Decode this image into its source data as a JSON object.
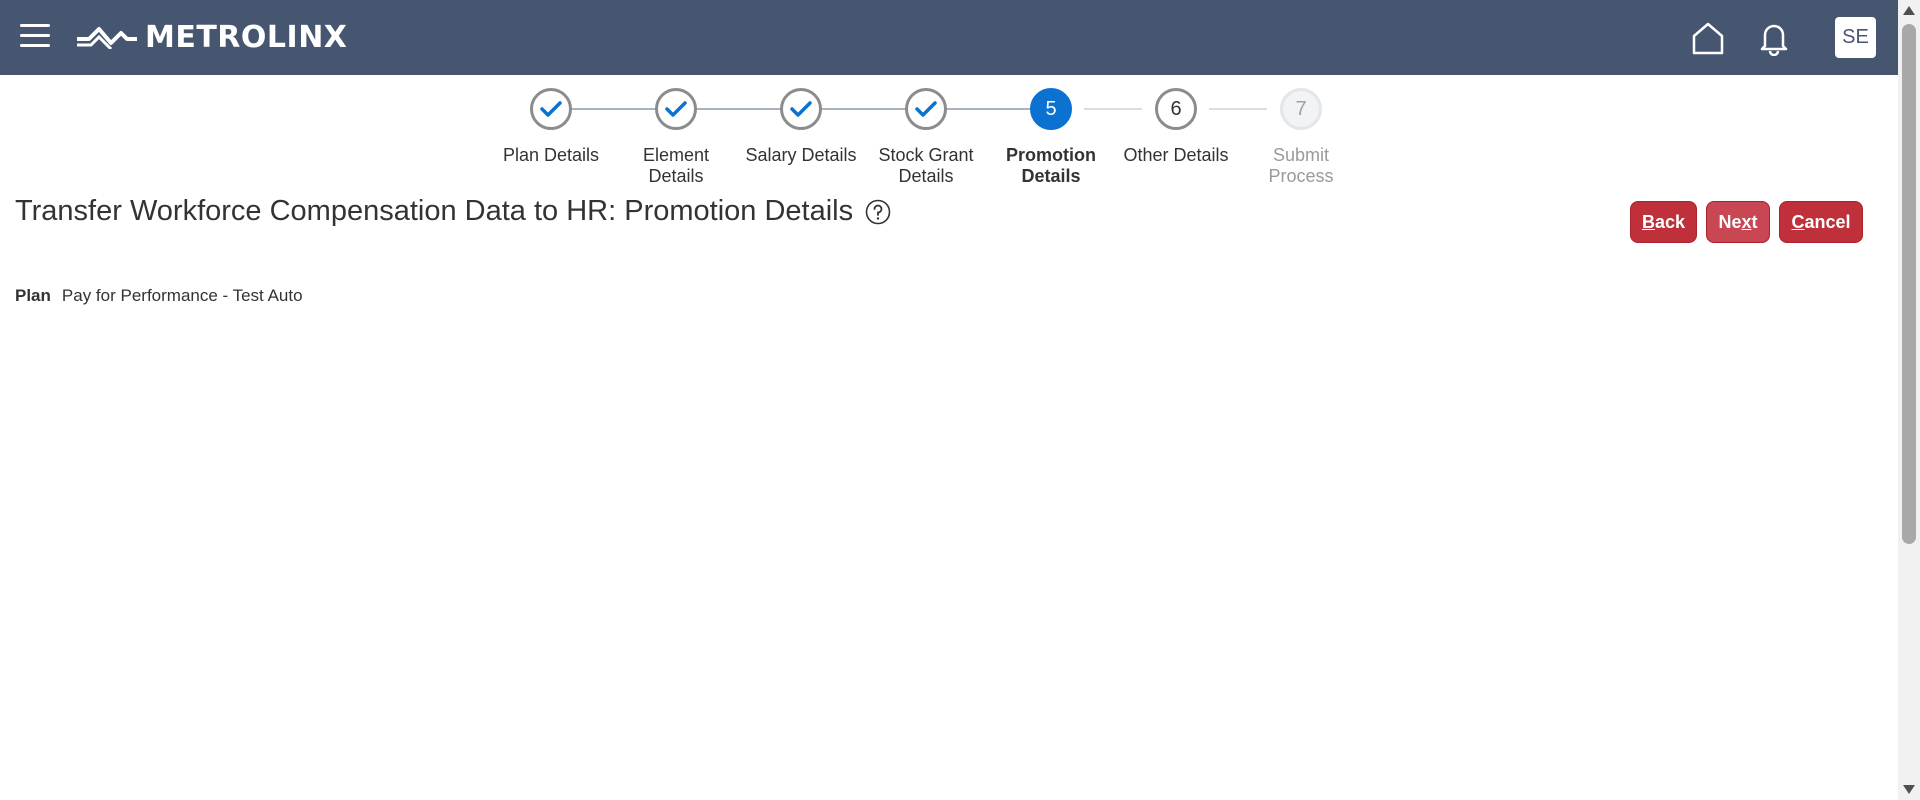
{
  "header": {
    "brand": "METROLINX",
    "avatar_initials": "SE",
    "bg_color": "#475670"
  },
  "train": {
    "steps": [
      {
        "marker": "",
        "label": "Plan Details",
        "state": "done"
      },
      {
        "marker": "",
        "label": "Element Details",
        "state": "done"
      },
      {
        "marker": "",
        "label": "Salary Details",
        "state": "done"
      },
      {
        "marker": "",
        "label": "Stock Grant Details",
        "state": "done"
      },
      {
        "marker": "5",
        "label": "Promotion Details",
        "state": "current"
      },
      {
        "marker": "6",
        "label": "Other Details",
        "state": "next"
      },
      {
        "marker": "7",
        "label": "Submit Process",
        "state": "disabled"
      }
    ],
    "current_color": "#0b72d1"
  },
  "page": {
    "title": "Transfer Workforce Compensation Data to HR: Promotion Details"
  },
  "buttons": {
    "back": {
      "access_key": "B",
      "rest": "ack"
    },
    "next": {
      "pre": "Ne",
      "access_key": "x",
      "rest": "t"
    },
    "cancel": {
      "access_key": "C",
      "rest": "ancel"
    },
    "color": "#c0303a"
  },
  "plan": {
    "label": "Plan",
    "value": "Pay for Performance - Test Auto"
  }
}
